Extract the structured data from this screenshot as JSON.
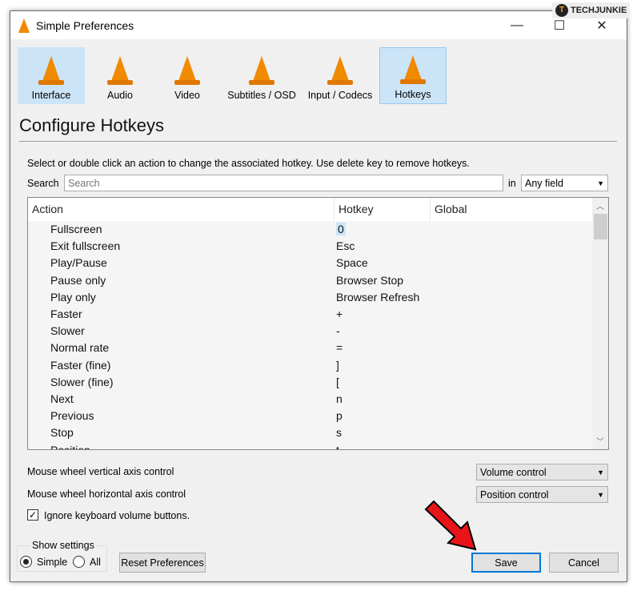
{
  "window": {
    "title": "Simple Preferences",
    "minimize": "—",
    "maximize": "☐",
    "close": "✕"
  },
  "watermark": "TECHJUNKIE",
  "categories": [
    {
      "label": "Interface",
      "color": "#2a9a2a"
    },
    {
      "label": "Audio"
    },
    {
      "label": "Video"
    },
    {
      "label": "Subtitles / OSD"
    },
    {
      "label": "Input / Codecs"
    },
    {
      "label": "Hotkeys"
    }
  ],
  "selected_category": "Hotkeys",
  "heading": "Configure Hotkeys",
  "instructions": "Select or double click an action to change the associated hotkey. Use delete key to remove hotkeys.",
  "search": {
    "label": "Search",
    "placeholder": "Search",
    "in_label": "in",
    "field": "Any field"
  },
  "table": {
    "columns": [
      "Action",
      "Hotkey",
      "Global"
    ],
    "rows": [
      [
        "Fullscreen",
        "0"
      ],
      [
        "Exit fullscreen",
        "Esc"
      ],
      [
        "Play/Pause",
        "Space"
      ],
      [
        "Pause only",
        "Browser Stop"
      ],
      [
        "Play only",
        "Browser Refresh"
      ],
      [
        "Faster",
        "+"
      ],
      [
        "Slower",
        "-"
      ],
      [
        "Normal rate",
        "="
      ],
      [
        "Faster (fine)",
        "]"
      ],
      [
        "Slower (fine)",
        "["
      ],
      [
        "Next",
        "n"
      ],
      [
        "Previous",
        "p"
      ],
      [
        "Stop",
        "s"
      ],
      [
        "Position",
        "t"
      ]
    ]
  },
  "wheel_vertical": {
    "label": "Mouse wheel vertical axis control",
    "value": "Volume control"
  },
  "wheel_horizontal": {
    "label": "Mouse wheel horizontal axis control",
    "value": "Position control"
  },
  "ignore_volume": {
    "label": "Ignore keyboard volume buttons.",
    "checked": true
  },
  "show_settings": {
    "label": "Show settings",
    "simple": "Simple",
    "all": "All",
    "selected": "Simple"
  },
  "buttons": {
    "reset": "Reset Preferences",
    "save": "Save",
    "cancel": "Cancel"
  },
  "colors": {
    "accent": "#0078d7",
    "arrow": "#e8141a",
    "cone": "#f08a00"
  }
}
